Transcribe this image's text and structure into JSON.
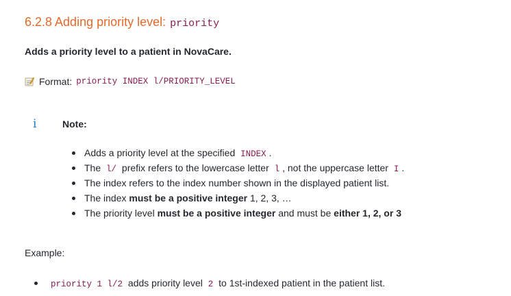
{
  "section": {
    "title": "6.2.8 Adding priority level:",
    "title_code": "priority",
    "description": "Adds a priority level to a patient in NovaCare."
  },
  "format": {
    "icon": "memo-icon",
    "label": "Format:",
    "code": "priority INDEX l/PRIORITY_LEVEL"
  },
  "note": {
    "icon": "info-icon",
    "icon_glyph": "i",
    "title": "Note:",
    "items": [
      {
        "t1": "Adds a priority level at the specified",
        "c1": "INDEX",
        "t2": "."
      },
      {
        "t1": "The",
        "c1": "l/",
        "t2": "prefix refers to the lowercase letter",
        "c2": "l",
        "t3": ", not the uppercase letter",
        "c3": "I",
        "t4": "."
      },
      {
        "t1": "The index refers to the index number shown in the displayed patient list."
      },
      {
        "t1": "The index",
        "b1": "must be a positive integer",
        "t2": "1, 2, 3, …"
      },
      {
        "t1": "The priority level",
        "b1": "must be a positive integer",
        "t2": "and must be",
        "b2": "either 1, 2, or 3"
      }
    ]
  },
  "example": {
    "label": "Example:",
    "items": [
      {
        "c1": "priority 1 l/2",
        "t1": "adds priority level",
        "c2": "2",
        "t2": "to 1st-indexed patient in the patient list."
      }
    ]
  }
}
